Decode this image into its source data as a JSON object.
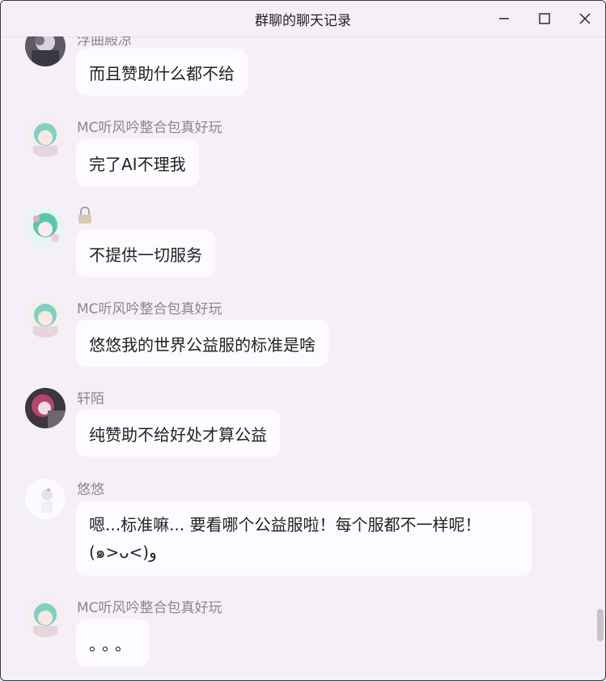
{
  "window": {
    "title": "群聊的聊天记录"
  },
  "messages": [
    {
      "name": "浮曲殿凉",
      "text": "而且赞助什么都不给"
    },
    {
      "name": "MC听风吟整合包真好玩",
      "text": "完了AI不理我"
    },
    {
      "name": "",
      "name_icon": "lock-icon",
      "text": "不提供一切服务"
    },
    {
      "name": "MC听风吟整合包真好玩",
      "text": "悠悠我的世界公益服的标准是啥"
    },
    {
      "name": "轩陌",
      "text": "纯赞助不给好处才算公益"
    },
    {
      "name": "悠悠",
      "text_line1": "嗯...标准嘛... 要看哪个公益服啦！每个服都不一样呢！",
      "text_line2": "(๑>ᴗ<)و"
    },
    {
      "name": "MC听风吟整合包真好玩",
      "text": "。。。"
    }
  ],
  "colors": {
    "background": "#f5f0f8",
    "bubble": "#fdfbff",
    "name": "#8a8590",
    "text": "#222222"
  }
}
